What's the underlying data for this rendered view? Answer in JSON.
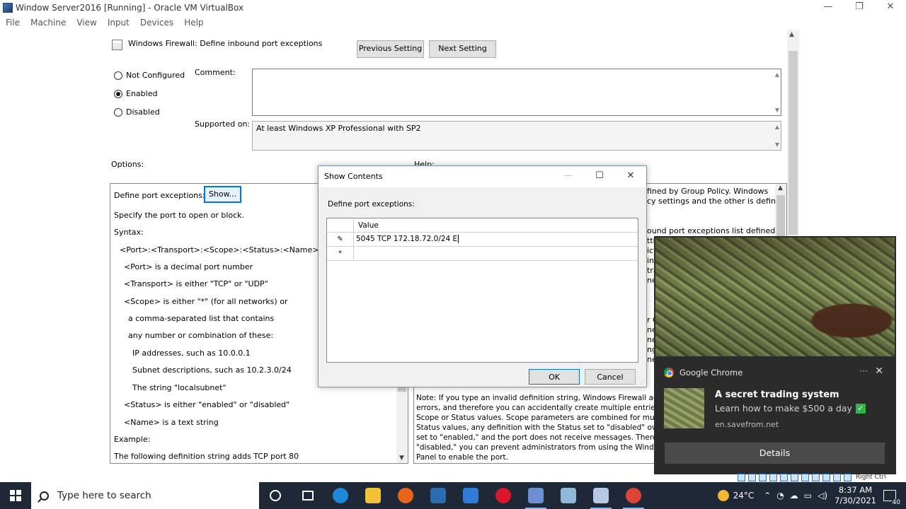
{
  "host": {
    "title": "Window Server2016 [Running] - Oracle VM VirtualBox",
    "menu": [
      "File",
      "Machine",
      "View",
      "Input",
      "Devices",
      "Help"
    ],
    "controls": {
      "minimize": "—",
      "restore": "❐",
      "close": "✕"
    }
  },
  "policy": {
    "title": "Windows Firewall: Define inbound port exceptions",
    "previous_label": "Previous Setting",
    "next_label": "Next Setting",
    "radios": [
      {
        "label": "Not Configured",
        "checked": false
      },
      {
        "label": "Enabled",
        "checked": true
      },
      {
        "label": "Disabled",
        "checked": false
      }
    ],
    "comment_label": "Comment:",
    "supported_label": "Supported on:",
    "supported_value": "At least Windows XP Professional with SP2",
    "options_label": "Options:",
    "help_label": "Help:",
    "options": {
      "define_label": "Define port exceptions:",
      "show_label": "Show...",
      "lines": [
        "Specify the port to open or block.",
        "Syntax:",
        "<Port>:<Transport>:<Scope>:<Status>:<Name>",
        "<Port> is a decimal port number",
        "<Transport> is either \"TCP\" or \"UDP\"",
        "<Scope> is either \"*\" (for all networks) or",
        "a comma-separated list that contains",
        "any number or combination of these:",
        "IP addresses, such as 10.0.0.1",
        "Subnet descriptions, such as 10.2.3.0/24",
        "The string \"localsubnet\"",
        "<Status> is either \"enabled\" or \"disabled\"",
        "<Name> is a text string",
        "Example:",
        "The following definition string adds TCP port 80"
      ]
    },
    "help": {
      "fragments": [
        "fined by Group Policy. Windows",
        "cy settings and the other is defined",
        "ound port exceptions list defined by",
        "tti",
        "ict",
        "ine",
        "tra",
        "ne",
        "r G",
        "ne",
        "ne",
        "ng",
        "ne"
      ],
      "note": [
        "Note: If you type an invalid definition string, Windows Firewall adds",
        "errors, and therefore you can accidentally create multiple entries for",
        "Scope or Status values. Scope parameters are combined for multiple",
        "Status values, any definition with the Status set to \"disabled\" overrid",
        "set to \"enabled,\" and the port does not receive messages. Therefore,",
        "\"disabled,\" you can prevent administrators from using the Windows",
        "Panel to enable the port."
      ]
    }
  },
  "dialog": {
    "title": "Show Contents",
    "prompt": "Define port exceptions:",
    "column": "Value",
    "rows": [
      {
        "marker": "✎",
        "value": "5045 TCP 172.18.72.0/24 E"
      },
      {
        "marker": "*",
        "value": ""
      }
    ],
    "ok_label": "OK",
    "cancel_label": "Cancel"
  },
  "notification": {
    "app": "Google Chrome",
    "more": "···",
    "close": "✕",
    "headline": "A secret trading system",
    "body": "Learn how to make $500 a day",
    "url": "en.savefrom.net",
    "action": "Details"
  },
  "vbox_status": {
    "host_key": "Right Ctrl"
  },
  "taskbar": {
    "search_placeholder": "Type here to search",
    "apps": [
      {
        "name": "cortana",
        "color": "#1f2836",
        "active": false
      },
      {
        "name": "task-view",
        "color": "#1f2836",
        "active": false
      },
      {
        "name": "edge",
        "color": "#1e88d8",
        "active": false
      },
      {
        "name": "file-explorer",
        "color": "#f2c33a",
        "active": false
      },
      {
        "name": "firefox",
        "color": "#e8641b",
        "active": false
      },
      {
        "name": "store",
        "color": "#2b6cb0",
        "active": false
      },
      {
        "name": "mail",
        "color": "#2f7bd6",
        "active": false
      },
      {
        "name": "opera",
        "color": "#d8172a",
        "active": false
      },
      {
        "name": "virtualbox",
        "color": "#6b8fd1",
        "active": true
      },
      {
        "name": "notepad",
        "color": "#8fb8d9",
        "active": false
      },
      {
        "name": "virtualbox-2",
        "color": "#b6c8e6",
        "active": true
      },
      {
        "name": "chrome",
        "color": "#db4437",
        "active": true
      }
    ],
    "weather": "24°C",
    "time": "8:37 AM",
    "date": "7/30/2021",
    "notif_count": "40"
  }
}
